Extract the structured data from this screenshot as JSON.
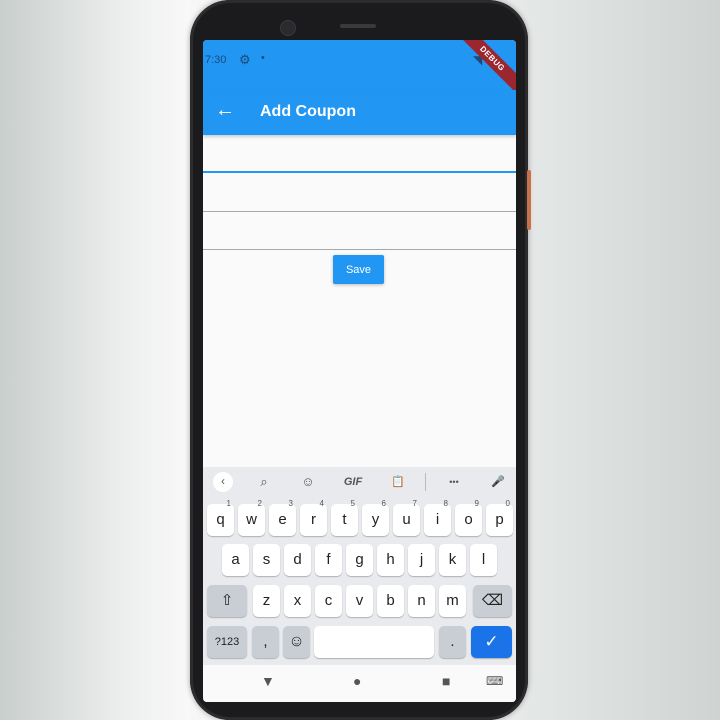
{
  "status": {
    "time": "7:30",
    "settings_icon": "gear-icon",
    "notification_icon": "dot-icon",
    "signal_icon": "wifi-icon",
    "banner": "DEBUG"
  },
  "appbar": {
    "title": "Add Coupon",
    "back_icon": "back-arrow-icon"
  },
  "form": {
    "fields": [
      {
        "name": "coupon-field-1",
        "value": "",
        "focused": true
      },
      {
        "name": "coupon-field-2",
        "value": ""
      },
      {
        "name": "coupon-field-3",
        "value": ""
      }
    ],
    "save_label": "Save"
  },
  "keyboard": {
    "toolbar": {
      "collapse": "‹",
      "search": "⌕",
      "sticker": "☺",
      "gif": "GIF",
      "clipboard": "📋",
      "more": "•••",
      "mic": "🎤"
    },
    "row1": [
      {
        "k": "q",
        "n": "1"
      },
      {
        "k": "w",
        "n": "2"
      },
      {
        "k": "e",
        "n": "3"
      },
      {
        "k": "r",
        "n": "4"
      },
      {
        "k": "t",
        "n": "5"
      },
      {
        "k": "y",
        "n": "6"
      },
      {
        "k": "u",
        "n": "7"
      },
      {
        "k": "i",
        "n": "8"
      },
      {
        "k": "o",
        "n": "9"
      },
      {
        "k": "p",
        "n": "0"
      }
    ],
    "row2": [
      "a",
      "s",
      "d",
      "f",
      "g",
      "h",
      "j",
      "k",
      "l"
    ],
    "row3": [
      "z",
      "x",
      "c",
      "v",
      "b",
      "n",
      "m"
    ],
    "shift": "⇧",
    "backspace": "⌫",
    "symbols": "?123",
    "comma": ",",
    "emoji": "☺",
    "space": "",
    "period": ".",
    "enter": "✓"
  },
  "navbar": {
    "back": "▼",
    "home": "●",
    "recents": "■",
    "keyboard": "⌨"
  },
  "colors": {
    "primary": "#2196f3",
    "debug_ribbon": "#9b2630",
    "keyboard_bg": "#e8eaed",
    "enter_key": "#1a73e8"
  }
}
